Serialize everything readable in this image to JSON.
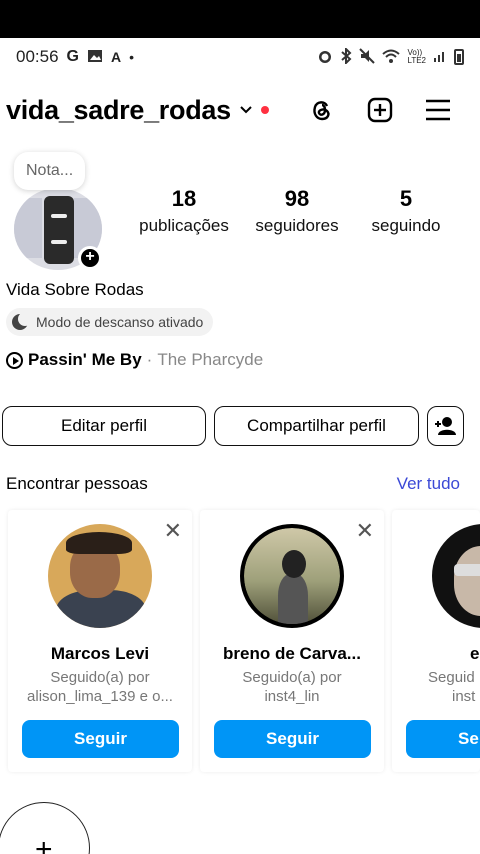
{
  "status_bar": {
    "time": "00:56",
    "left_icons": [
      "google-icon",
      "image-icon",
      "text-icon",
      "dot-icon"
    ],
    "right_icons": [
      "alarm-icon",
      "bluetooth-icon",
      "mute-icon",
      "wifi-icon",
      "volte-icon",
      "signal-icon",
      "battery-icon"
    ],
    "volte": "Vo))\nLTE2"
  },
  "header": {
    "username": "vida_sadre_rodas",
    "icons": [
      "threads-icon",
      "create-icon",
      "menu-icon"
    ],
    "notification_color": "#ff3040"
  },
  "profile": {
    "note": "Nota...",
    "stats": [
      {
        "value": "18",
        "label": "publicações"
      },
      {
        "value": "98",
        "label": "seguidores"
      },
      {
        "value": "5",
        "label": "seguindo"
      }
    ],
    "full_name": "Vida Sobre Rodas",
    "status_badge": "Modo de descanso ativado",
    "music": {
      "song": "Passin' Me By",
      "separator": "·",
      "artist": "The Pharcyde"
    }
  },
  "actions": {
    "edit": "Editar perfil",
    "share": "Compartilhar perfil"
  },
  "suggestions": {
    "title": "Encontrar pessoas",
    "see_all": "Ver tudo",
    "accent": "#3b49d6",
    "follow_color": "#0095f6",
    "cards": [
      {
        "name": "Marcos Levi",
        "sub1": "Seguido(a) por",
        "sub2": "alison_lima_139 e o...",
        "button": "Seguir"
      },
      {
        "name": "breno de Carva...",
        "sub1": "Seguido(a) por",
        "sub2": "inst4_lin",
        "button": "Seguir"
      },
      {
        "name": "e",
        "sub1": "Seguid",
        "sub2": "inst",
        "button": "Se"
      }
    ]
  }
}
